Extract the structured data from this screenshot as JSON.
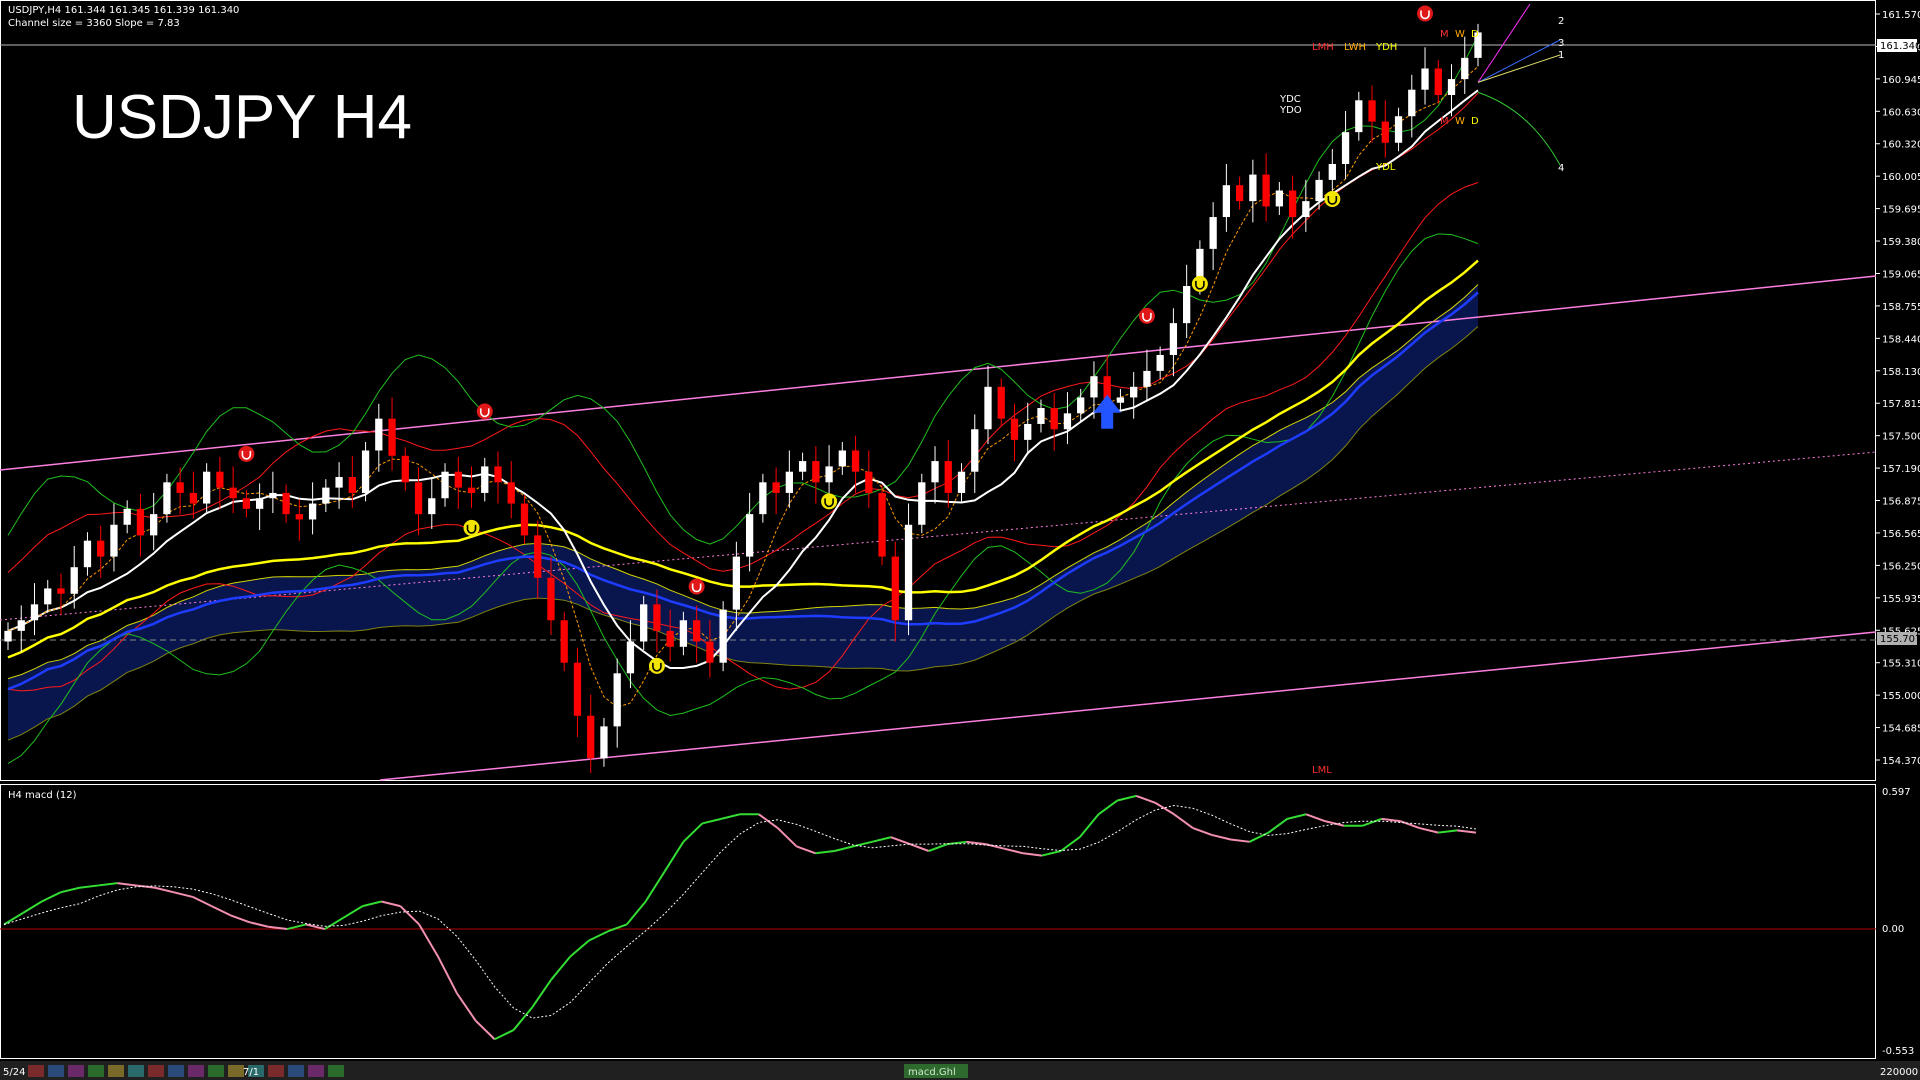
{
  "header": {
    "symbol_line": "USDJPY,H4  161.344 161.345 161.339 161.340",
    "channel_line": "Channel size = 3360 Slope = 7.83",
    "overlay_title": "USDJPY H4"
  },
  "price_axis": {
    "labels": [
      "161.570",
      "161.260",
      "160.945",
      "160.630",
      "160.320",
      "160.005",
      "159.695",
      "159.380",
      "159.065",
      "158.755",
      "158.440",
      "158.130",
      "157.815",
      "157.500",
      "157.190",
      "156.875",
      "156.565",
      "156.250",
      "155.935",
      "155.625",
      "155.310",
      "155.000",
      "154.685",
      "154.370"
    ],
    "current_price": "161.340",
    "marker_price": "155.707"
  },
  "levels": {
    "lmh": "LMH",
    "lwh": "LWH",
    "ydh": "YDH",
    "ydc": "YDC",
    "ydo": "YDO",
    "ydl": "YDL",
    "lml": "LML",
    "fan_labels": [
      "2",
      "3",
      "1",
      "4"
    ],
    "mwd_top": [
      "M",
      "W",
      "D"
    ],
    "mwd_bottom": [
      "M",
      "W",
      "D"
    ]
  },
  "macd_panel": {
    "title": "H4  macd (12)",
    "axis_labels": [
      "0.597",
      "0.00",
      "-0.553"
    ]
  },
  "bottom_bar": {
    "date_left": "5/24",
    "date_mid": "7/1",
    "tab_label": "macd.Ghl",
    "right_label": "220000"
  },
  "colors": {
    "bull_candle": "#ffffff",
    "bear_candle": "#ff0000",
    "ma_white": "#ffffff",
    "ma_yellow": "#ffff00",
    "ma_blue": "#1e3cff",
    "bollinger": "#ff1a1a",
    "envelope_green": "#1fbf1f",
    "kumo_yellow": "#d4d400",
    "channel_pink": "#ff7fe0",
    "macd_up": "#33dd33",
    "macd_down": "#f28fb2",
    "signal": "#ffffff"
  },
  "chart_data": {
    "type": "candlestick",
    "symbol": "USDJPY",
    "timeframe": "H4",
    "ylim": [
      154.37,
      161.57
    ],
    "last_price": 161.34,
    "open": 161.344,
    "high": 161.345,
    "low": 161.339,
    "close": 161.34,
    "closes": [
      155.7,
      155.8,
      155.95,
      156.1,
      156.05,
      156.3,
      156.55,
      156.4,
      156.7,
      156.85,
      156.6,
      156.8,
      157.1,
      157.0,
      156.9,
      157.2,
      157.05,
      156.95,
      156.85,
      156.95,
      157.0,
      156.8,
      156.75,
      156.9,
      157.05,
      157.15,
      157.0,
      157.4,
      157.7,
      157.35,
      157.1,
      156.8,
      156.95,
      157.2,
      157.05,
      157.0,
      157.25,
      157.1,
      156.9,
      156.6,
      156.2,
      155.8,
      155.4,
      154.9,
      154.5,
      154.8,
      155.3,
      155.6,
      155.95,
      155.7,
      155.55,
      155.8,
      155.6,
      155.4,
      155.9,
      156.4,
      156.8,
      157.1,
      157.0,
      157.2,
      157.3,
      157.1,
      157.25,
      157.4,
      157.2,
      157.0,
      156.4,
      155.8,
      156.7,
      157.1,
      157.3,
      157.0,
      157.2,
      157.6,
      158.0,
      157.7,
      157.5,
      157.65,
      157.8,
      157.6,
      157.75,
      157.9,
      158.1,
      157.85,
      157.9,
      158.0,
      158.15,
      158.3,
      158.6,
      158.95,
      159.3,
      159.6,
      159.9,
      159.75,
      160.0,
      159.7,
      159.85,
      159.6,
      159.75,
      159.95,
      160.1,
      160.4,
      160.7,
      160.5,
      160.3,
      160.55,
      160.8,
      161.0,
      160.75,
      160.9,
      161.1,
      161.34
    ],
    "series": [
      {
        "name": "ma_white"
      },
      {
        "name": "ma_yellow"
      },
      {
        "name": "ma_blue"
      }
    ],
    "macd_ylim": [
      -0.553,
      0.597
    ],
    "macd_values": [
      0.02,
      0.07,
      0.12,
      0.16,
      0.18,
      0.19,
      0.2,
      0.19,
      0.18,
      0.16,
      0.14,
      0.1,
      0.06,
      0.03,
      0.01,
      0.0,
      0.02,
      0.0,
      0.05,
      0.1,
      0.12,
      0.1,
      0.02,
      -0.12,
      -0.28,
      -0.4,
      -0.48,
      -0.44,
      -0.34,
      -0.22,
      -0.12,
      -0.05,
      -0.01,
      0.02,
      0.12,
      0.25,
      0.38,
      0.46,
      0.48,
      0.5,
      0.5,
      0.44,
      0.36,
      0.33,
      0.34,
      0.36,
      0.38,
      0.4,
      0.37,
      0.34,
      0.37,
      0.38,
      0.37,
      0.35,
      0.33,
      0.32,
      0.34,
      0.4,
      0.5,
      0.56,
      0.58,
      0.55,
      0.5,
      0.44,
      0.41,
      0.39,
      0.38,
      0.42,
      0.48,
      0.5,
      0.47,
      0.45,
      0.45,
      0.48,
      0.47,
      0.44,
      0.42,
      0.43,
      0.42
    ]
  }
}
